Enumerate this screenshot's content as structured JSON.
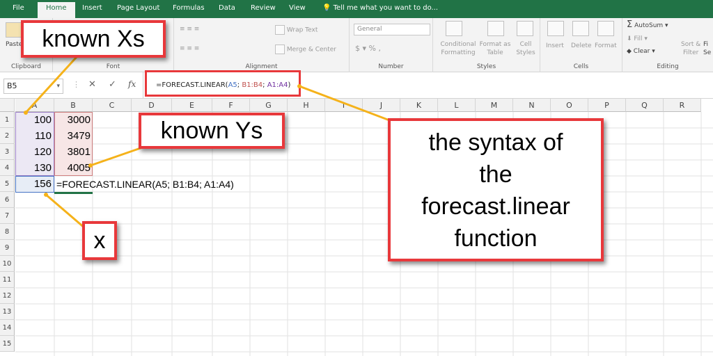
{
  "tabs": [
    "File",
    "Home",
    "Insert",
    "Page Layout",
    "Formulas",
    "Data",
    "Review",
    "View"
  ],
  "tell_me": "Tell me what you want to do...",
  "ribbon": {
    "clipboard": {
      "paste": "Paste",
      "label": "Clipboard"
    },
    "font": {
      "label": "Font"
    },
    "alignment": {
      "wrap_text": "Wrap Text",
      "merge_center": "Merge & Center",
      "label": "Alignment"
    },
    "number": {
      "format": "General",
      "percent": "%",
      "label": "Number"
    },
    "styles": {
      "conditional": "Conditional",
      "formatting": "Formatting",
      "format_as": "Format as",
      "table": "Table",
      "cell": "Cell",
      "styles_btn": "Styles",
      "label": "Styles"
    },
    "cells": {
      "insert": "Insert",
      "delete": "Delete",
      "format": "Format",
      "label": "Cells"
    },
    "editing": {
      "autosum": "AutoSum",
      "fill": "Fill",
      "clear": "Clear",
      "sort": "Sort &",
      "filter": "Filter",
      "find": "Fi",
      "select": "Se",
      "label": "Editing"
    }
  },
  "formula_bar": {
    "name_box": "B5",
    "fx": "fx",
    "f_prefix": "=FORECAST.LINEAR(",
    "f_arg1": "A5",
    "f_sep1": "; ",
    "f_arg2": "B1:B4",
    "f_sep2": "; ",
    "f_arg3": "A1:A4",
    "f_suffix": ")"
  },
  "columns": [
    "A",
    "B",
    "C",
    "D",
    "E",
    "F",
    "G",
    "H",
    "I",
    "J",
    "K",
    "L",
    "M",
    "N",
    "O",
    "P",
    "Q",
    "R"
  ],
  "rows": [
    "1",
    "2",
    "3",
    "4",
    "5",
    "6",
    "7",
    "8",
    "9",
    "10",
    "11",
    "12",
    "13",
    "14",
    "15"
  ],
  "cells": {
    "a1": "100",
    "a2": "110",
    "a3": "120",
    "a4": "130",
    "a5": "156",
    "b1": "3000",
    "b2": "3479",
    "b3": "3801",
    "b4": "4005",
    "b5": "=FORECAST.LINEAR(A5; B1:B4; A1:A4)"
  },
  "callouts": {
    "known_xs": "known Xs",
    "known_ys": "known Ys",
    "x": "x",
    "syntax": [
      "the syntax of",
      "the",
      "forecast.linear",
      "function"
    ]
  },
  "colors": {
    "excel_green": "#217346",
    "callout_border": "#e8383b",
    "arrow": "#f5b21a",
    "ref_blue": "#4472c4",
    "ref_red": "#c0504d",
    "ref_purple": "#7030a0"
  }
}
